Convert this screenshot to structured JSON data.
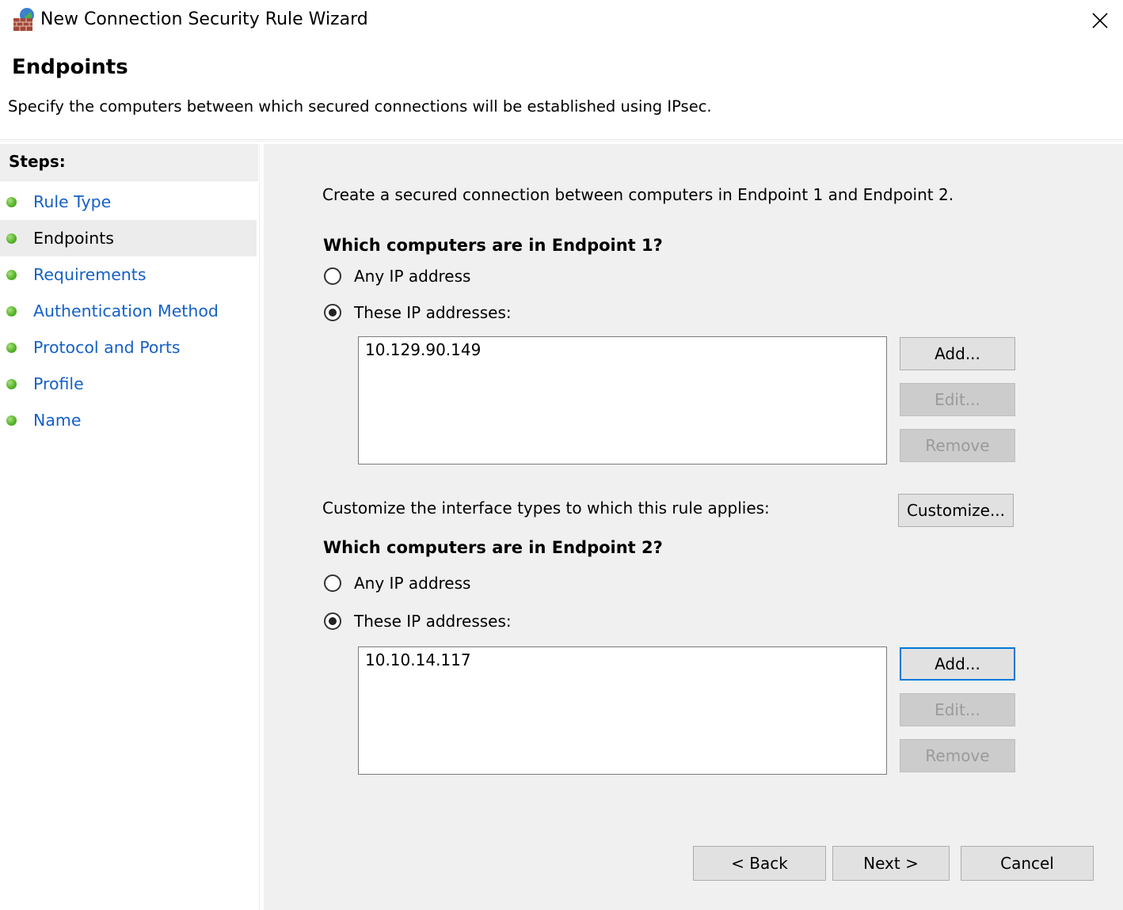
{
  "window": {
    "title": "New Connection Security Rule Wizard",
    "icon": "firewall-globe-icon",
    "close_glyph": "✕"
  },
  "header": {
    "title": "Endpoints",
    "description": "Specify the computers between which secured connections will be established using IPsec."
  },
  "steps": {
    "header": "Steps:",
    "items": [
      {
        "label": "Rule Type",
        "active": false
      },
      {
        "label": "Endpoints",
        "active": true
      },
      {
        "label": "Requirements",
        "active": false
      },
      {
        "label": "Authentication Method",
        "active": false
      },
      {
        "label": "Protocol and Ports",
        "active": false
      },
      {
        "label": "Profile",
        "active": false
      },
      {
        "label": "Name",
        "active": false
      }
    ]
  },
  "main": {
    "intro": "Create a secured connection between computers in Endpoint 1 and Endpoint 2.",
    "endpoint1": {
      "heading": "Which computers are in Endpoint 1?",
      "any_ip_label": "Any IP address",
      "these_ip_label": "These IP addresses:",
      "selected": "these",
      "addresses": [
        "10.129.90.149"
      ],
      "add_label": "Add...",
      "edit_label": "Edit...",
      "remove_label": "Remove"
    },
    "customize_text": "Customize the interface types to which this rule applies:",
    "customize_label": "Customize...",
    "endpoint2": {
      "heading": "Which computers are in Endpoint 2?",
      "any_ip_label": "Any IP address",
      "these_ip_label": "These IP addresses:",
      "selected": "these",
      "addresses": [
        "10.10.14.117"
      ],
      "add_label": "Add...",
      "edit_label": "Edit...",
      "remove_label": "Remove"
    }
  },
  "footer": {
    "back_label": "< Back",
    "next_label": "Next >",
    "cancel_label": "Cancel"
  },
  "colors": {
    "link": "#1560c6",
    "step_dot": "#58b52c",
    "focus": "#0078d7",
    "panel": "#f0f0f0"
  }
}
